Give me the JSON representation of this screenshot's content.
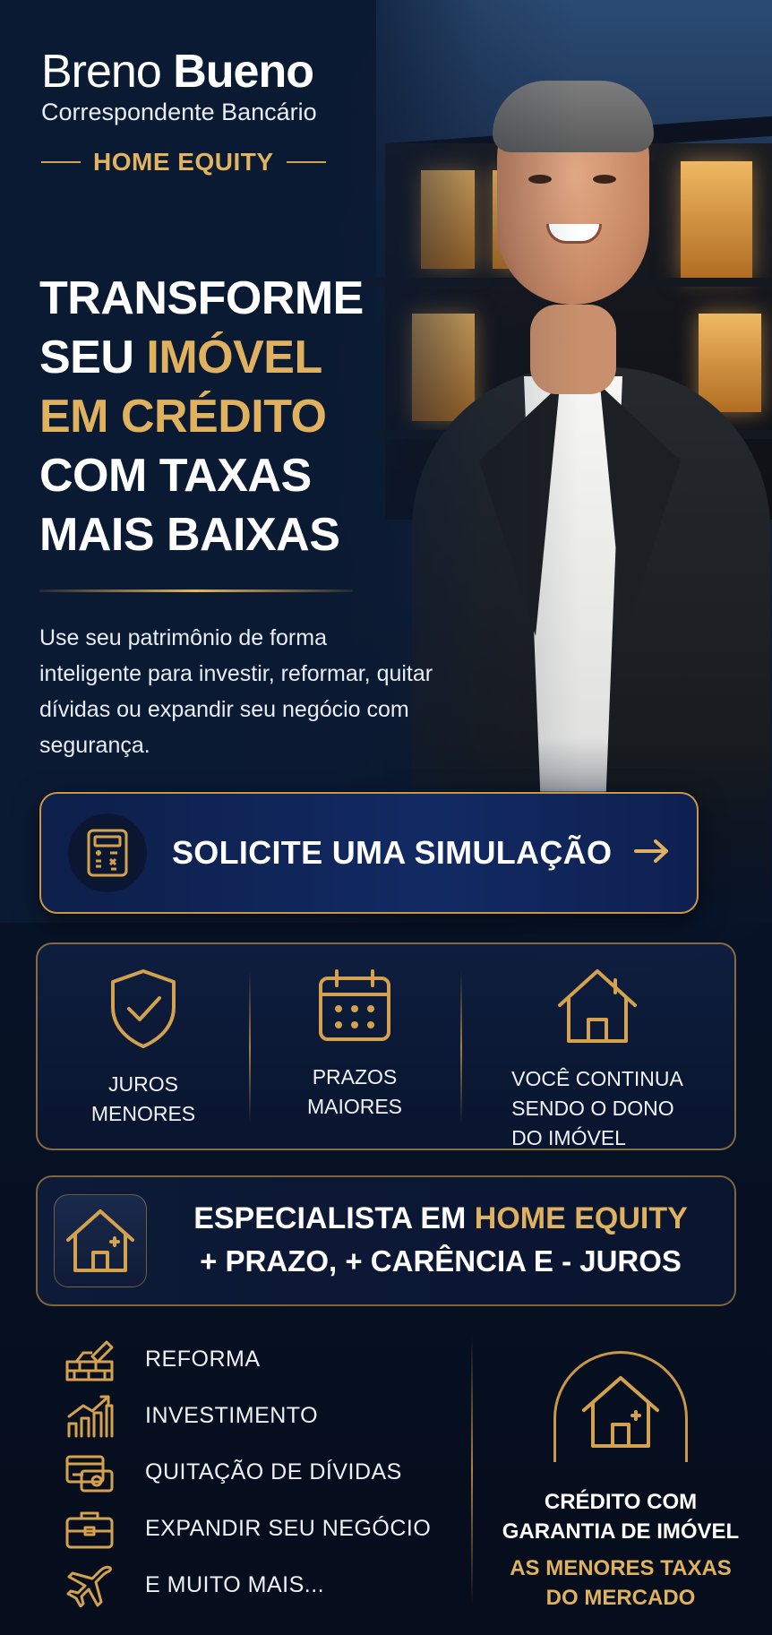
{
  "brand": {
    "first_name": "Breno",
    "last_name": "Bueno",
    "subtitle": "Correspondente Bancário",
    "tag": "HOME EQUITY"
  },
  "headline": {
    "line1": "TRANSFORME",
    "line2_white": "SEU ",
    "line2_gold": "IMÓVEL",
    "line3_gold": "EM CRÉDITO",
    "line4": "COM TAXAS",
    "line5": "MAIS BAIXAS"
  },
  "lead": "Use seu patrimônio de forma inteligente para investir, reformar, quitar dívidas ou expandir seu negócio com segurança.",
  "cta": {
    "label": "SOLICITE UMA SIMULAÇÃO",
    "icon": "calculator-icon"
  },
  "benefits": [
    {
      "icon": "shield-check-icon",
      "label": "JUROS\nMENORES"
    },
    {
      "icon": "calendar-icon",
      "label": "PRAZOS\nMAIORES"
    },
    {
      "icon": "house-icon",
      "label": "VOCÊ CONTINUA\nSENDO O DONO\nDO IMÓVEL"
    }
  ],
  "specialist": {
    "title_white": "ESPECIALISTA EM ",
    "title_gold": "HOME EQUITY",
    "subtitle": "+ PRAZO, + CARÊNCIA E - JUROS",
    "icon": "house-icon"
  },
  "uses": [
    {
      "icon": "brick-trowel-icon",
      "label": "REFORMA"
    },
    {
      "icon": "growth-chart-icon",
      "label": "INVESTIMENTO"
    },
    {
      "icon": "money-card-icon",
      "label": "QUITAÇÃO DE DÍVIDAS"
    },
    {
      "icon": "briefcase-icon",
      "label": "EXPANDIR SEU NEGÓCIO"
    },
    {
      "icon": "airplane-icon",
      "label": "E MUITO MAIS..."
    }
  ],
  "badge": {
    "icon": "house-icon",
    "title": "CRÉDITO COM\nGARANTIA DE IMÓVEL",
    "highlight": "AS MENORES TAXAS\nDO MERCADO"
  },
  "colors": {
    "gold": "#e0b15f",
    "navy": "#0b1a33",
    "cta_blue": "#122a63"
  }
}
